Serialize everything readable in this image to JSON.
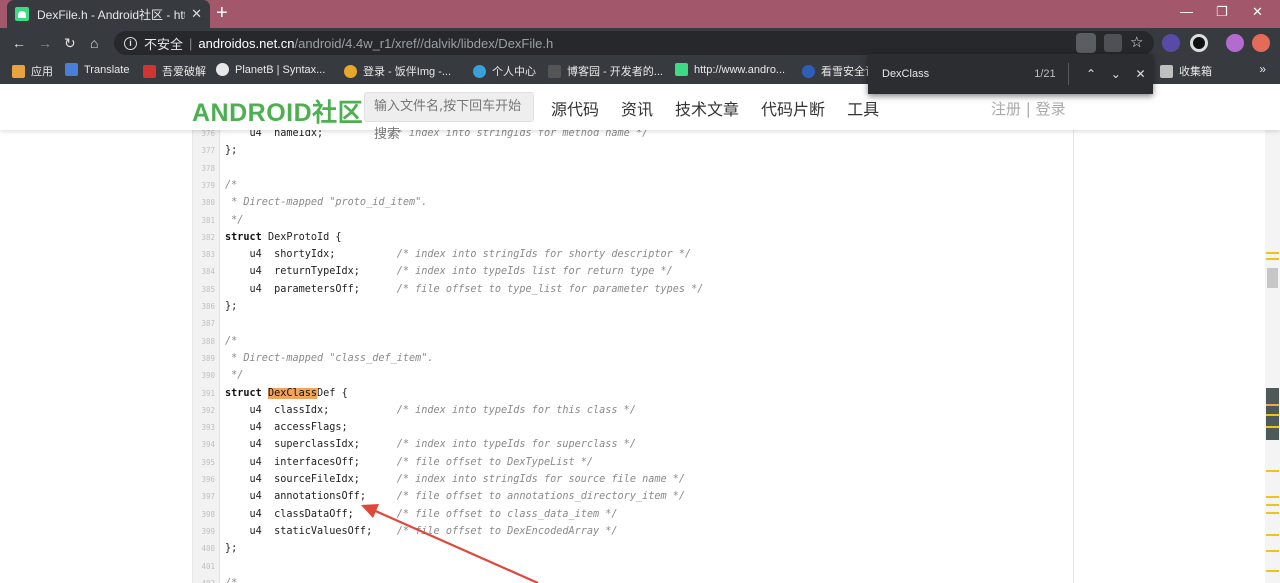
{
  "browser": {
    "tab_title": "DexFile.h - Android社区 - http:",
    "tab_close": "✕",
    "newtab_label": "+",
    "security_label": "不安全",
    "url_domain": "androidos.net.cn",
    "url_path": "/android/4.4w_r1/xref//dalvik/libdex/DexFile.h",
    "window_controls": [
      "—",
      "❐",
      "✕"
    ],
    "nav": {
      "back": "←",
      "forward": "→",
      "reload": "↻",
      "home": "⌂"
    },
    "bookmarks": [
      {
        "label": "应用",
        "icon": "apps-grid-icon",
        "color": "#e8a33d"
      },
      {
        "label": "Translate",
        "icon": "translate-icon",
        "color": "#4a7fd8"
      },
      {
        "label": "吾爱破解",
        "icon": "52pojie-icon",
        "color": "#d23434"
      },
      {
        "label": "PlanetB | Syntax...",
        "icon": "globe-icon",
        "color": "#e8e8e8"
      },
      {
        "label": "登录 - 饭伴Img -...",
        "icon": "chrome-icon",
        "color": "#e6a82c"
      },
      {
        "label": "个人中心",
        "icon": "personal-center-icon",
        "color": "#3aa0d8"
      },
      {
        "label": "博客园 - 开发者的...",
        "icon": "cnblogs-icon",
        "color": "#555"
      },
      {
        "label": "http://www.andro...",
        "icon": "android-icon",
        "color": "#3ddc84"
      },
      {
        "label": "看雪安全论",
        "icon": "kanxue-icon",
        "color": "#2d5fb8"
      },
      {
        "label": "收集箱",
        "icon": "folder-icon",
        "color": "#c0c0c0"
      }
    ],
    "bookmarks_more": "»"
  },
  "findbar": {
    "query": "DexClass",
    "count": "1/21",
    "prev": "⌃",
    "next": "⌄",
    "close": "✕"
  },
  "site": {
    "logo": "ANDROID社区",
    "search_placeholder": "输入文件名,按下回车开始搜索",
    "nav": [
      "源代码",
      "资讯",
      "技术文章",
      "代码片断",
      "工具"
    ],
    "register": "注册",
    "auth_sep": " | ",
    "login": "登录"
  },
  "code": [
    {
      "n": "376",
      "t": "    u4  nameIdx;           /* index into stringIds for method name */"
    },
    {
      "n": "377",
      "t": "};"
    },
    {
      "n": "378",
      "t": ""
    },
    {
      "n": "379",
      "t": "/*"
    },
    {
      "n": "380",
      "t": " * Direct-mapped \"proto_id_item\"."
    },
    {
      "n": "381",
      "t": " */"
    },
    {
      "n": "382",
      "t": "struct DexProtoId {"
    },
    {
      "n": "383",
      "t": "    u4  shortyIdx;          /* index into stringIds for shorty descriptor */"
    },
    {
      "n": "384",
      "t": "    u4  returnTypeIdx;      /* index into typeIds list for return type */"
    },
    {
      "n": "385",
      "t": "    u4  parametersOff;      /* file offset to type_list for parameter types */"
    },
    {
      "n": "386",
      "t": "};"
    },
    {
      "n": "387",
      "t": ""
    },
    {
      "n": "388",
      "t": "/*"
    },
    {
      "n": "389",
      "t": " * Direct-mapped \"class_def_item\"."
    },
    {
      "n": "390",
      "t": " */"
    },
    {
      "n": "391",
      "t": "struct DexClassDef {"
    },
    {
      "n": "392",
      "t": "    u4  classIdx;           /* index into typeIds for this class */"
    },
    {
      "n": "393",
      "t": "    u4  accessFlags;"
    },
    {
      "n": "394",
      "t": "    u4  superclassIdx;      /* index into typeIds for superclass */"
    },
    {
      "n": "395",
      "t": "    u4  interfacesOff;      /* file offset to DexTypeList */"
    },
    {
      "n": "396",
      "t": "    u4  sourceFileIdx;      /* index into stringIds for source file name */"
    },
    {
      "n": "397",
      "t": "    u4  annotationsOff;     /* file offset to annotations_directory_item */"
    },
    {
      "n": "398",
      "t": "    u4  classDataOff;       /* file offset to class_data_item */"
    },
    {
      "n": "399",
      "t": "    u4  staticValuesOff;    /* file offset to DexEncodedArray */"
    },
    {
      "n": "400",
      "t": "};"
    },
    {
      "n": "401",
      "t": ""
    },
    {
      "n": "402",
      "t": "/*"
    }
  ],
  "highlight_term": "DexClass",
  "colors": {
    "tab_strip": "#a3576a",
    "chrome_dark": "#373a3f",
    "logo_green": "#4caf50",
    "find_highlight": "#f0a35a",
    "annotation_arrow": "#e0463a",
    "scroll_marker": "#f0c31a"
  }
}
